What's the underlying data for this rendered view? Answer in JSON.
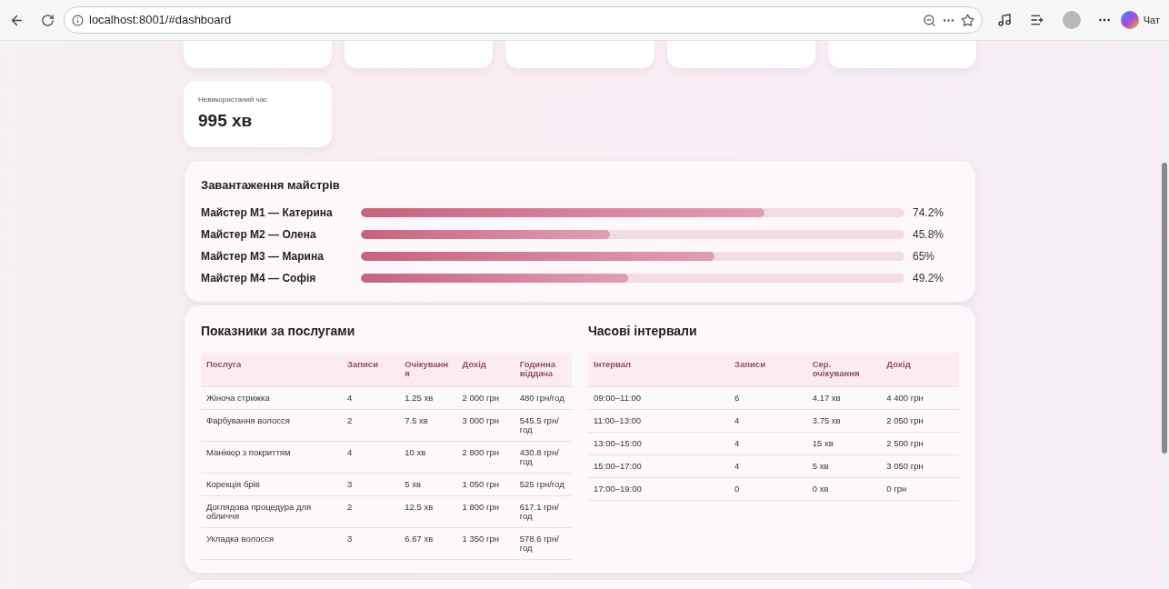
{
  "browser": {
    "url": "localhost:8001/#dashboard",
    "chat_label": "Чат"
  },
  "summary_cards": [
    {
      "label": "Невикористаний час",
      "value": "995 хв"
    }
  ],
  "masters": {
    "title": "Завантаження майстрів",
    "items": [
      {
        "name": "Майстер М1 — Катерина",
        "level": 0.742,
        "reading": "74.2%"
      },
      {
        "name": "Майстер М2 — Олена",
        "level": 0.458,
        "reading": "45.8%"
      },
      {
        "name": "Майстер М3 — Марина",
        "level": 0.65,
        "reading": "65%"
      },
      {
        "name": "Майстер М4 — Софія",
        "level": 0.492,
        "reading": "49.2%"
      }
    ]
  },
  "services": {
    "title": "Показники за послугами",
    "columns": [
      "Послуга",
      "Записи",
      "Очікуванн я",
      "Дохід",
      "Годинна віддача"
    ],
    "rows": [
      [
        "Жіноча стрижка",
        "4",
        "1.25 хв",
        "2 000 грн",
        "480 грн/год"
      ],
      [
        "Фарбування волосся",
        "2",
        "7.5 хв",
        "3 000 грн",
        "545.5 грн/ год"
      ],
      [
        "Манікюр з покриттям",
        "4",
        "10 хв",
        "2 800 грн",
        "430.8 грн/ год"
      ],
      [
        "Корекція брів",
        "3",
        "5 хв",
        "1 050 грн",
        "525 грн/год"
      ],
      [
        "Доглядова процедура для обличчя",
        "2",
        "12.5 хв",
        "1 800 грн",
        "617.1 грн/ год"
      ],
      [
        "Укладка волосся",
        "3",
        "6.67 хв",
        "1 350 грн",
        "578.6 грн/ год"
      ]
    ]
  },
  "intervals": {
    "title": "Часові інтервали",
    "columns": [
      "Інтервал",
      "Записи",
      "Сер. очікування",
      "Дохід"
    ],
    "rows": [
      [
        "09:00–11:00",
        "6",
        "4.17 хв",
        "4 400 грн"
      ],
      [
        "11:00–13:00",
        "4",
        "3.75 хв",
        "2 050 грн"
      ],
      [
        "13:00–15:00",
        "4",
        "15 хв",
        "2 500 грн"
      ],
      [
        "15:00–17:00",
        "4",
        "5 хв",
        "3 050 грн"
      ],
      [
        "17:00–19:00",
        "0",
        "0 хв",
        "0 грн"
      ]
    ]
  }
}
